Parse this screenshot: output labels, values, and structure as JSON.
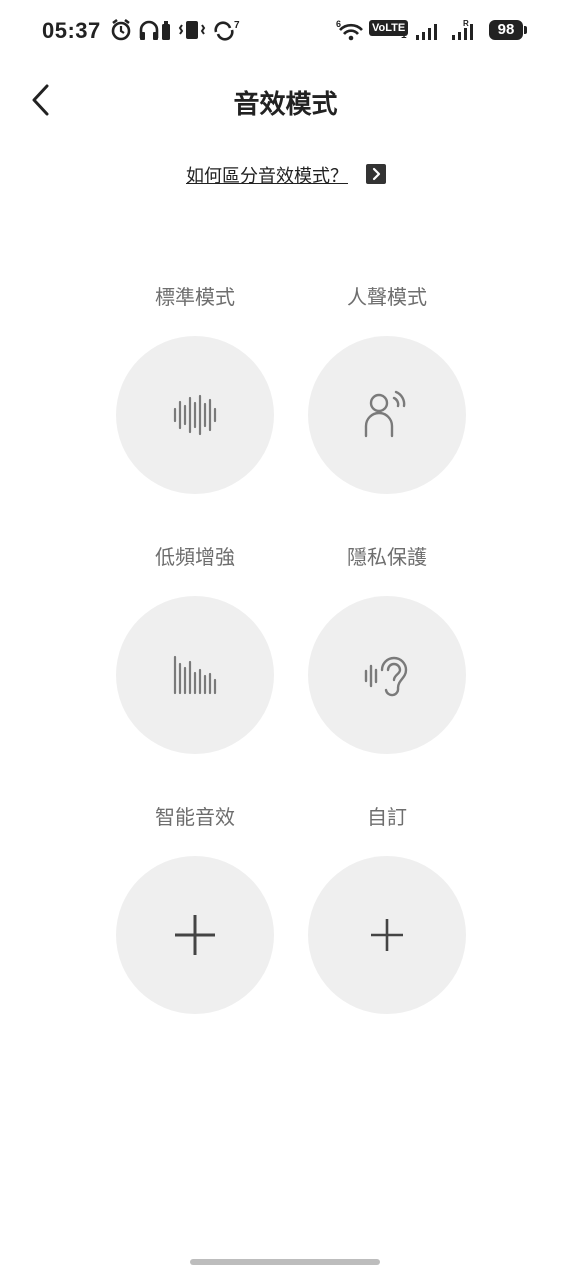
{
  "status_bar": {
    "time": "05:37",
    "volte": "VoLTE",
    "volte_sub": "1",
    "battery": "98"
  },
  "header": {
    "title": "音效模式"
  },
  "help": {
    "link_text": "如何區分音效模式？"
  },
  "modes": [
    {
      "label": "標準模式",
      "icon": "waveform-icon"
    },
    {
      "label": "人聲模式",
      "icon": "voice-person-icon"
    },
    {
      "label": "低頻增強",
      "icon": "bass-bars-icon"
    },
    {
      "label": "隱私保護",
      "icon": "ear-icon"
    },
    {
      "label": "智能音效",
      "icon": "plus-icon"
    },
    {
      "label": "自訂",
      "icon": "plus-icon"
    }
  ],
  "colors": {
    "circle_bg": "#efefef",
    "label": "#6e6e6e",
    "icon": "#7a7a7a"
  }
}
